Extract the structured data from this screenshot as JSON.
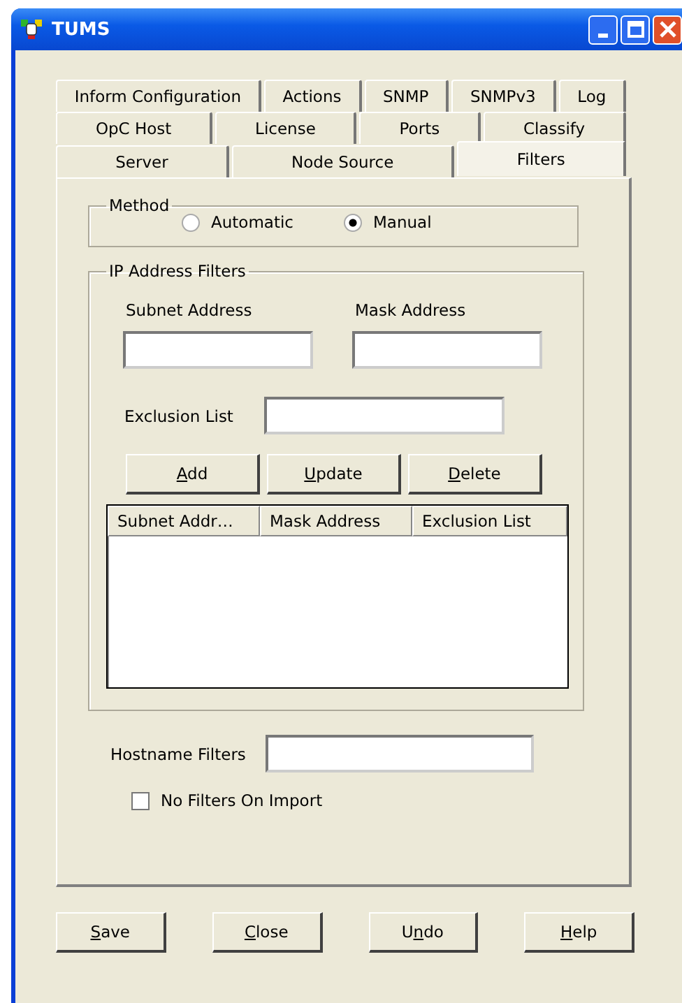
{
  "window": {
    "title": "TUMS"
  },
  "tab_rows": [
    {
      "tabs": [
        {
          "label": "Inform Configuration",
          "selected": false
        },
        {
          "label": "Actions",
          "selected": false
        },
        {
          "label": "SNMP",
          "selected": false
        },
        {
          "label": "SNMPv3",
          "selected": false
        },
        {
          "label": "Log",
          "selected": false
        }
      ]
    },
    {
      "tabs": [
        {
          "label": "OpC Host",
          "selected": false
        },
        {
          "label": "License",
          "selected": false
        },
        {
          "label": "Ports",
          "selected": false
        },
        {
          "label": "Classify",
          "selected": false
        }
      ]
    },
    {
      "tabs": [
        {
          "label": "Server",
          "selected": false
        },
        {
          "label": "Node Source",
          "selected": false
        },
        {
          "label": "Filters",
          "selected": true
        }
      ]
    }
  ],
  "method": {
    "title": "Method",
    "options": [
      {
        "label": "Automatic",
        "selected": false
      },
      {
        "label": "Manual",
        "selected": true
      }
    ]
  },
  "ip_filters": {
    "title": "IP Address Filters",
    "subnet_label": "Subnet Address",
    "mask_label": "Mask Address",
    "exclusion_label": "Exclusion List",
    "buttons": [
      {
        "label": [
          {
            "text": "A",
            "underline": true
          },
          {
            "text": "dd",
            "underline": false
          }
        ]
      },
      {
        "label": [
          {
            "text": "U",
            "underline": true
          },
          {
            "text": "pdate",
            "underline": false
          }
        ]
      },
      {
        "label": [
          {
            "text": "D",
            "underline": true
          },
          {
            "text": "elete",
            "underline": false
          }
        ]
      }
    ],
    "table": {
      "columns": [
        "Subnet Addr…",
        "Mask Address",
        "Exclusion List"
      ]
    }
  },
  "hostname_label": "Hostname Filters",
  "no_filters": {
    "label": "No Filters On Import",
    "checked": false
  },
  "buttons": [
    {
      "label": [
        {
          "text": "S",
          "underline": true
        },
        {
          "text": "ave",
          "underline": false
        }
      ]
    },
    {
      "label": [
        {
          "text": "C",
          "underline": true
        },
        {
          "text": "lose",
          "underline": false
        }
      ]
    },
    {
      "label": [
        {
          "text": "U",
          "underline": false
        },
        {
          "text": "n",
          "underline": true
        },
        {
          "text": "do",
          "underline": false
        }
      ]
    },
    {
      "label": [
        {
          "text": "H",
          "underline": true
        },
        {
          "text": "elp",
          "underline": false
        }
      ]
    }
  ]
}
